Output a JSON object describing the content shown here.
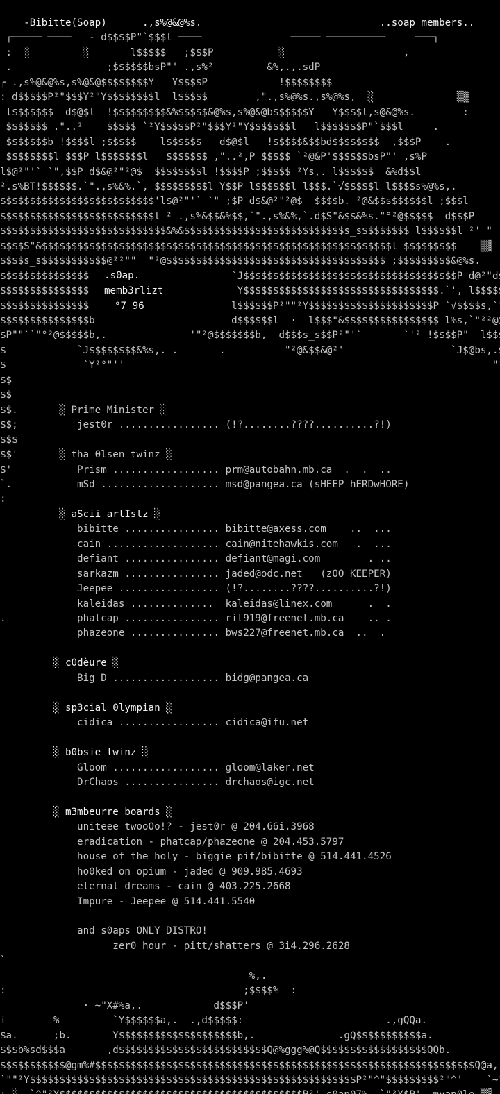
{
  "header": {
    "left_title": "-Bibitte(Soap)",
    "right_title": "..soap members.."
  },
  "logo": {
    "word": ".s0ap.",
    "subtitle": "memb3rlizt",
    "date": "°7 96"
  },
  "groups": [
    {
      "title": "Prime Minister",
      "members": [
        {
          "handle": "jest0r",
          "contact": "(!?........????..........?!)",
          "note": ""
        }
      ]
    },
    {
      "title": "tha 0lsen twinz",
      "members": [
        {
          "handle": "Prism",
          "contact": "prm@autobahn.mb.ca",
          "note": ""
        },
        {
          "handle": "mSd",
          "contact": "msd@pangea.ca",
          "note": "(sHEEP hERDwHORE)"
        }
      ]
    },
    {
      "title": "aScii artIstz",
      "members": [
        {
          "handle": "bibitte",
          "contact": "bibitte@axess.com",
          "note": ""
        },
        {
          "handle": "cain",
          "contact": "cain@nitehawkis.com",
          "note": ""
        },
        {
          "handle": "defiant",
          "contact": "defiant@magi.com",
          "note": ""
        },
        {
          "handle": "sarkazm",
          "contact": "jaded@odc.net",
          "note": "(zOO KEEPER)"
        },
        {
          "handle": "Jeepee",
          "contact": "(!?........????..........?!)",
          "note": ""
        },
        {
          "handle": "kaleidas",
          "contact": "kaleidas@linex.com",
          "note": ""
        },
        {
          "handle": "phatcap",
          "contact": "rit919@freenet.mb.ca",
          "note": ""
        },
        {
          "handle": "phazeone",
          "contact": "bws227@freenet.mb.ca",
          "note": ""
        }
      ]
    },
    {
      "title": "c0dèure",
      "members": [
        {
          "handle": "Big D",
          "contact": "bidg@pangea.ca",
          "note": ""
        }
      ]
    },
    {
      "title": "sp3cial 0lympian",
      "members": [
        {
          "handle": "cidica",
          "contact": "cidica@ifu.net",
          "note": ""
        }
      ]
    },
    {
      "title": "b0bsie twinz",
      "members": [
        {
          "handle": "Gloom",
          "contact": "gloom@laker.net",
          "note": ""
        },
        {
          "handle": "DrChaos",
          "contact": "drchaos@igc.net",
          "note": ""
        }
      ]
    }
  ],
  "boards": {
    "title": "m3mbeurre boards",
    "items": [
      "uniteee twooOo!? - jest0r @ 204.66i.3968",
      "eradication - phatcap/phazeone @ 204.453.5797",
      "house of the holy - biggie pif/bibitte @ 514.441.4526",
      "ho0ked on opium - jaded @ 909.985.4693",
      "eternal dreams - cain @ 403.225.2668",
      "Impure - Jeepee @ 514.441.5540"
    ],
    "distro_label": "and s0aps ONLY DISTRO!",
    "distro_item": "zer0 hour - pitt/shatters @ 3i4.296.2628"
  },
  "footer": {
    "tag": "s0ap07%",
    "artist": "myan0le"
  },
  "art": [
    "",
    " ┌───── ────   - d$$$$P\"`$$$l ────               ───── ──────────     ───┐",
    " :  ░         ░       l$$$$$   ;$$$P           ░                    ,                          │",
    " .                ;$$$$$$bsP\"' .,s%²         &%,.,.sdP                                  │",
    "┌ .,s%@&@%s,s%@&@$$$$$$$$Y   Y$$$$P            !$$$$$$$$                               : ── ───",
    ": d$$$$$P²\"$$$Y²\"Y$$$$$$$$l  l$$$$$        ,\".,s%@%s.,s%@%s,  ░              ▒▒         ░",
    " l$$$$$$$  d$@$l  !$$$$$$$$$&%$$$$$&@%s,s%@&@b$$$$$$Y   Y$$$$l,s@&@%s.        :",
    " $$$$$$$ .\"..²    $$$$$ `²Y$$$$$P²\"$$$Y²\"Y$$$$$$$l   l$$$$$$$P\"`$$$l     .",
    " $$$$$$$b !$$$$l ;$$$$$    l$$$$$$   d$@$l   !$$$$$&$$bd$$$$$$$$  ,$$$P    .",
    " $$$$$$$$l $$$P l$$$$$$$l   $$$$$$$ ,\"..²,P $$$$$ `²@&P'$$$$$$bsP\"' ,s%P",
    "l$@²\"'` `\",$$P d$&@²\"²@$  $$$$$$$$l !$$$$P ;$$$$$ ²Ys,. l$$$$$$  &%d$$l",
    "².s%BT!$$$$$$.`\".,s%&%.`, $$$$$$$$$l Y$$P l$$$$$$l l$$$.`√$$$$$l l$$$$s%@%s,.",
    "$$$$$$$$$$$$$$$$$$$$$$$$$$'l$@²\"'` `\" ;$P d$&@²\"²@$  $$$$b. ²@&$$s$$$$$$l ;$$$l",
    "$$$$$$$$$$$$$$$$$$$$$$$$$$l ² .,s%&$$&%$$,`\".,s%&%,`.d$S\"&$$&%s.\"°²@$$$$$  d$$$P",
    "$$$$$$$$$$$$$$$$$$$$$$$$$$$$&%&$$$$$$$$$$$$$$$$$$$$$$$$$$$s_s$$$$$$$$ l$$$$$$l ²' \"",
    "$$$$S\"&$$$$$$$$$$$$$$$$$$$$$$$$$$$$$$$$$$$$$$$$$$$$$$$$$$$$$$$$$$$l $$$$$$$$$    ▒▒",
    "$$$$s_s$$$$$$$$$$$@²²\"\"  \"²@$$$$$$$$$$$$$$$$$$$$$$$$$$$$$$$$$$$$$ ;$$$$$$$$$&@%s.",
    "$$$$$$$$$$$$$$$P'                      `J$$$$$$$$$$$$$$$$$$$$$$$$$$$$$$$$$$$$P d@²\"d$$$$P\"`$$$l",
    "$$$$$$$$$$$$$$$P                        Y$$$$$$$$$$$$$$$$$$$$$$$$$$$$$$$$$.`', l$$$$$  ;$$$P",
    "$$$$$$$$$$$$$$$$                       l$$$$$$P²\"\"²Y$$$$$$$$$$$$$$$$$$$$$P `√$$$$s,`\"'",
    "$$$$$$$$$$$$$$$b                       d$$$$$$l  ·  l$$$\"&$$$$$$$$$$$$$$$$ l%s,`\"²²@@%s,.",
    "$P\"\"``\"°²@$$$$$b,.              '\"²@$$$$$$$b,  d$$$s_s$$P²\"'`       `'² !$$$$P\"  l$$$b",
    "$            `J$$$$$$$$&%s,. .       .          \"²@&$$&@²'                  `J$@bs,.$$$$$",
    "$             `Y²°\"''                                                              \"²@$$$$$$$P",
    "$$                                                                                       `~\"~'",
    "$$",
    "$$.       ░ Prime Minister ░",
    "$$;          jest0r ................. (!?........????..........?!)",
    "$$$",
    "$$'       ░ tha 0lsen twinz ░",
    "$'           Prism .................. prm@autobahn.mb.ca  .  .  ..",
    "`.           mSd .................... msd@pangea.ca (sHEEP hERDwHORE)",
    ":",
    "          ░ aScii artIstz ░",
    "             bibitte ................ bibitte@axess.com    ..  ...",
    "             cain ................... cain@nitehawkis.com   .  ...",
    "             defiant ................ defiant@magi.com        . ..",
    "             sarkazm ................ jaded@odc.net   (zOO KEEPER)",
    "             Jeepee ................. (!?........????..........?!)",
    "             kaleidas ..............  kaleidas@linex.com      .  .",
    ".            phatcap ................ rit919@freenet.mb.ca    .. .",
    "             phazeone ............... bws227@freenet.mb.ca  ..  .",
    "",
    "         ░ c0dèure ░",
    "             Big D .................. bidg@pangea.ca",
    "",
    "         ░ sp3cial 0lympian ░",
    "             cidica ................. cidica@ifu.net",
    "",
    "         ░ b0bsie twinz ░",
    "             Gloom .................. gloom@laker.net",
    "             DrChaos ................ drchaos@igc.net",
    "",
    "         ░ m3mbeurre boards ░",
    "             uniteee twooOo!? - jest0r @ 204.66i.3968",
    "             eradication - phatcap/phazeone @ 204.453.5797",
    "             house of the holy - biggie pif/bibitte @ 514.441.4526",
    "             ho0ked on opium - jaded @ 909.985.4693",
    "             eternal dreams - cain @ 403.225.2668",
    "             Impure - Jeepee @ 514.441.5540",
    "",
    "             and s0aps ONLY DISTRO!",
    "                   zer0 hour - pitt/shatters @ 3i4.296.2628",
    "`                                                                                               .",
    "                                          %,.                                                 g$",
    ":                                        ;$$$$%  :                                            $$",
    "              · ~\"X#%a,.            d$$$P'                                                   `$",
    "i        %         `Y$$$$$$a,.  .,d$$$$$:                        .,gQQa.                       `",
    "$a.      ;b.       Y$$$$$$$$$$$$$$$$$$$$b,.              .gQ$$$$$$$$$$$a.",
    "$$$b%sd$$$a       ,d$$$$$$$$$$$$$$$$$$$$$$$$$Q@%ggg%@Q$$$$$$$$$$$$$$$$$$QQb.           .",
    "$$$$$$$$$$$@gm%#$$$$$$$$$$$$$$$$$$$$$$$$$$$$$$$$$$$$$$$$$$$$$$$$$$$$$$$$$$$$$$$$Q@a,.   .d",
    "`\"\"²Y$$$$$$$$$$$$$$$$$$$$$$$$$$$$$$$$$$$$$$$$$$$$$$$$$$$$$$$P²\"^\"$$$$$$$$$²\"^'    `~\"²$$$$",
    ": ░ .`^\"²Y$$$$$$$$$$$$$$$$$$$$$$$$$$$$$$$$$$$$$$$$$P²' s0ap07%  `\"²Y$P'  myan0le ▒▒ │ `^\"",
    "└───── ───``\"\"~\"\"²²Y$$$$$$$$$$P²²\"\"\"~~''        ─────── ───── '         ──────── ┘"
  ]
}
